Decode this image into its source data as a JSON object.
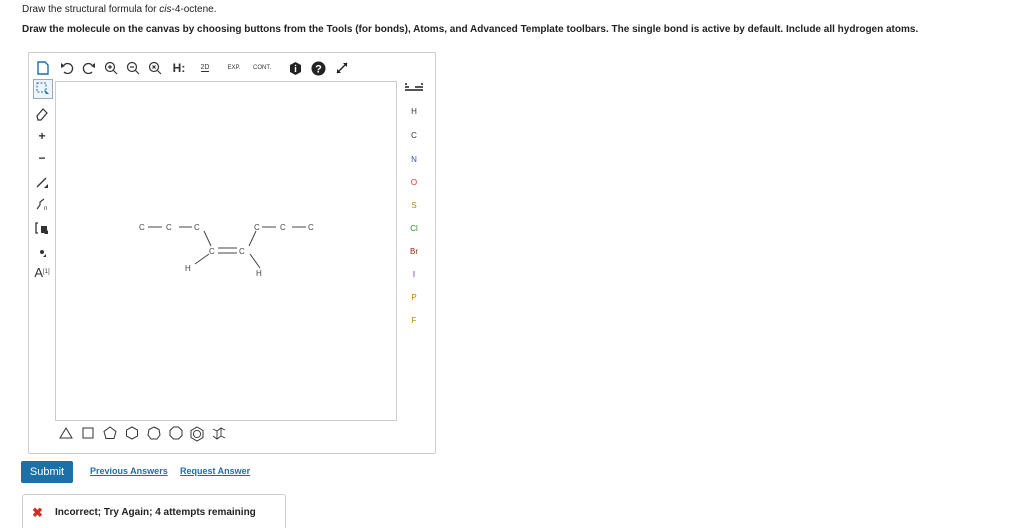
{
  "question": {
    "line1_prefix": "Draw the structural formula for ",
    "line1_compound": "cis",
    "line1_suffix": "-4-octene.",
    "line2": "Draw the molecule on the canvas by choosing buttons from the Tools (for bonds), Atoms, and Advanced Template toolbars. The single bond is active by default. Include all hydrogen atoms."
  },
  "toolbar": {
    "h_label": "H:",
    "label_2d": "2D",
    "label_exp": "EXP.",
    "label_cont": "CONT."
  },
  "left_tools": {
    "charge_plus": "+",
    "charge_minus": "−",
    "atom_label": "A",
    "atom_label_sup": "[1]"
  },
  "atoms": [
    "H",
    "C",
    "N",
    "O",
    "S",
    "Cl",
    "Br",
    "I",
    "P",
    "F"
  ],
  "molecule": {
    "atoms": [
      "C",
      "C",
      "C",
      "C",
      "C",
      "C",
      "C",
      "C",
      "H",
      "H"
    ]
  },
  "actions": {
    "submit": "Submit",
    "previous_answers": "Previous Answers",
    "request_answer": "Request Answer"
  },
  "feedback": {
    "icon": "x-icon",
    "message": "Incorrect; Try Again; 4 attempts remaining",
    "color": "#d62d20"
  },
  "colors": {
    "accent": "#1d6fa8",
    "error": "#d62d20"
  }
}
